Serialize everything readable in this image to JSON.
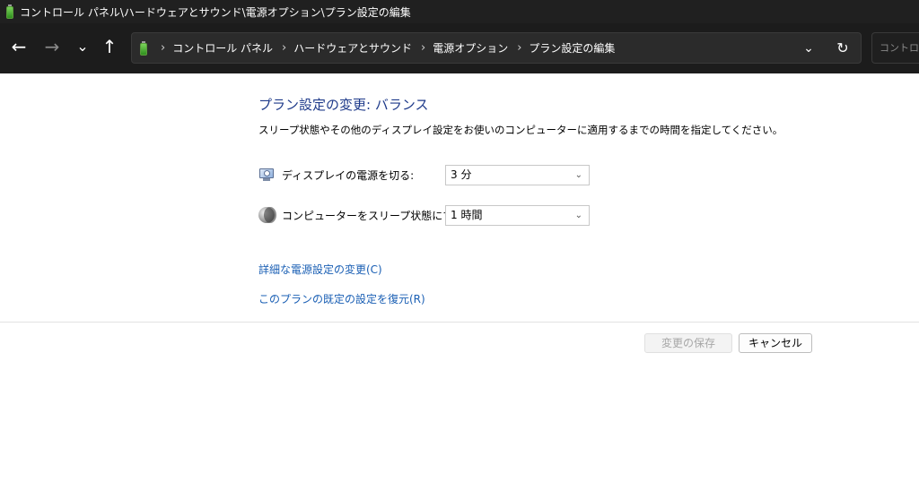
{
  "window": {
    "title": "コントロール パネル\\ハードウェアとサウンド\\電源オプション\\プラン設定の編集"
  },
  "navbar": {
    "back_icon": "←",
    "forward_icon": "→",
    "recent_icon": "⌄",
    "up_icon": "↑",
    "breadcrumb": [
      "コントロール パネル",
      "ハードウェアとサウンド",
      "電源オプション",
      "プラン設定の編集"
    ],
    "separator": "›",
    "dropdown_icon": "⌄",
    "refresh_icon": "↻",
    "search_placeholder": "コントロール パネル"
  },
  "main": {
    "heading": "プラン設定の変更: バランス",
    "description": "スリープ状態やその他のディスプレイ設定をお使いのコンピューターに適用するまでの時間を指定してください。",
    "settings": [
      {
        "icon": "monitor-clock-icon",
        "label": "ディスプレイの電源を切る:",
        "value": "3 分"
      },
      {
        "icon": "moon-icon",
        "label": "コンピューターをスリープ状態にする:",
        "value": "1 時間"
      }
    ],
    "links": {
      "advanced": "詳細な電源設定の変更(C)",
      "restore": "このプランの既定の設定を復元(R)"
    },
    "buttons": {
      "save": "変更の保存",
      "cancel": "キャンセル"
    }
  },
  "colors": {
    "heading": "#1e3a8a",
    "link": "#1a5fb4",
    "titlebar_bg": "#202020",
    "navbar_bg": "#1c1c1c"
  }
}
